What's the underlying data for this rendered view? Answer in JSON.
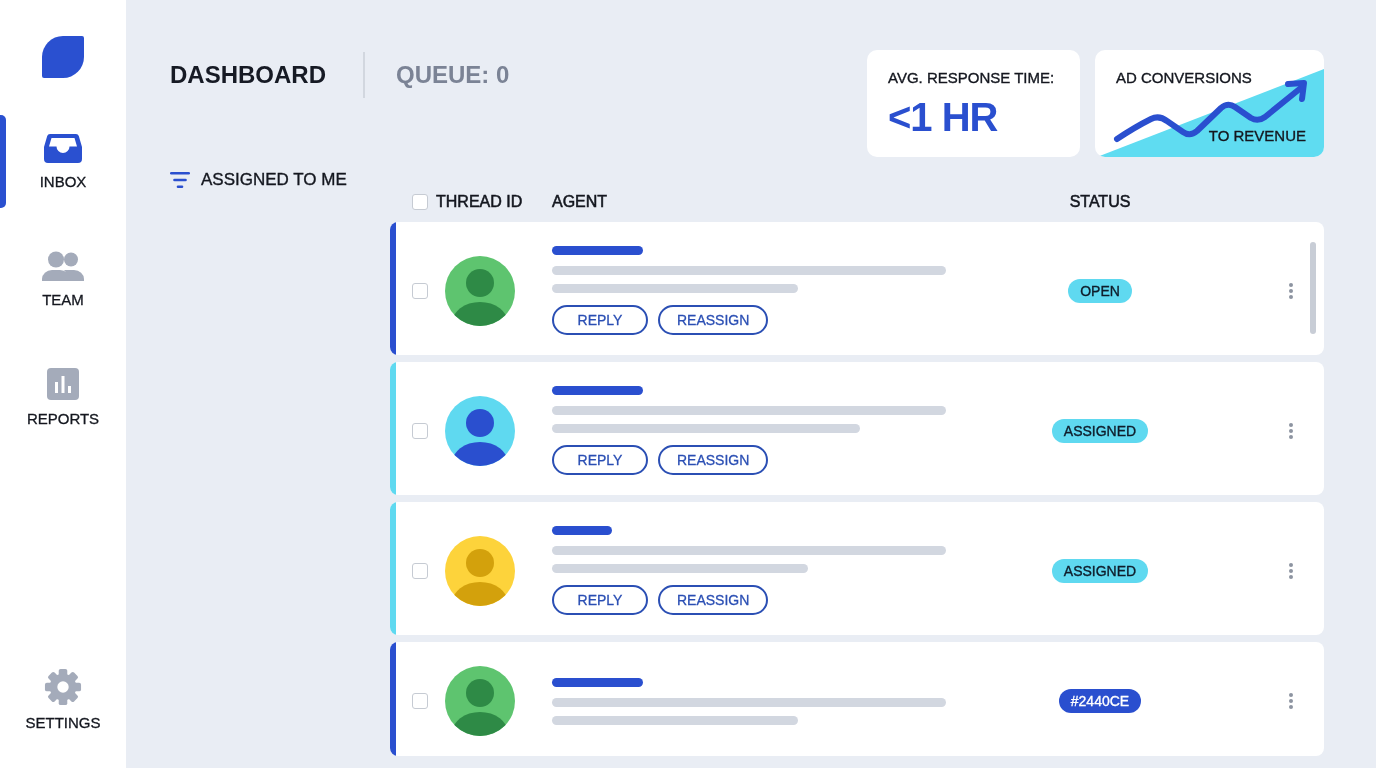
{
  "sidebar": {
    "items": [
      {
        "label": "INBOX",
        "selected": true
      },
      {
        "label": "TEAM",
        "selected": false
      },
      {
        "label": "REPORTS",
        "selected": false
      }
    ],
    "footer_items": [
      {
        "label": "SETTINGS",
        "selected": false
      }
    ]
  },
  "header": {
    "title": "DASHBOARD",
    "queue": "QUEUE: 0"
  },
  "metrics": [
    {
      "kind": "value",
      "label": "AVG. RESPONSE TIME:",
      "value": "<1 HR"
    },
    {
      "kind": "trend",
      "title": "AD CONVERSIONS",
      "caption": "TO REVENUE"
    }
  ],
  "filter": {
    "label": "ASSIGNED TO ME"
  },
  "table": {
    "select_all": {
      "checked": false
    },
    "columns": [
      "THREAD ID",
      "AGENT",
      "STATUS"
    ],
    "rows": [
      {
        "checked": false,
        "color": "#2a4fcf",
        "avatar": {
          "color": "#5ec46f",
          "figure": {
            "color": "#2e8a46"
          }
        },
        "status": {
          "text": "OPEN",
          "color": "#5fd9f0"
        },
        "actions": [
          "REPLY",
          "REASSIGN"
        ]
      },
      {
        "checked": false,
        "color": "#5fd9f0",
        "avatar": {
          "color": "#5fd9f0",
          "figure": {
            "color": "#2a4fcf"
          }
        },
        "status": {
          "text": "ASSIGNED",
          "color": "#5fd9f0"
        },
        "actions": [
          "REPLY",
          "REASSIGN"
        ]
      },
      {
        "checked": false,
        "color": "#5fd9f0",
        "avatar": {
          "color": "#fdd33b",
          "figure": {
            "color": "#d3a10c"
          }
        },
        "status": {
          "text": "ASSIGNED",
          "color": "#5fd9f0"
        },
        "actions": [
          "REPLY",
          "REASSIGN"
        ]
      },
      {
        "checked": false,
        "color": "#2a4fcf",
        "avatar": {
          "color": "#5ec46f",
          "figure": {
            "color": "#2e8a46"
          }
        },
        "status": {
          "text": "#2440CE",
          "color": "#2a4fcf"
        }
      }
    ]
  }
}
